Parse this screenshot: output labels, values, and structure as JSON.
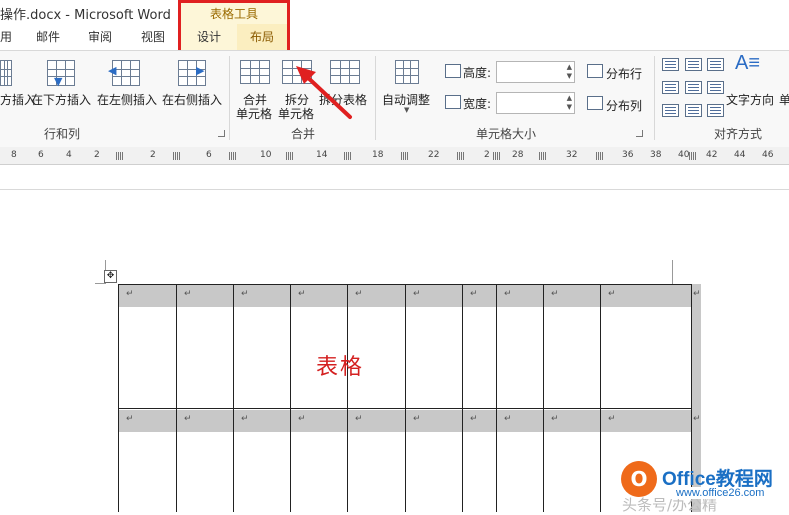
{
  "window": {
    "title": "操作.docx - Microsoft Word"
  },
  "tabs": [
    "用",
    "邮件",
    "审阅",
    "视图"
  ],
  "context_tabs": {
    "group_title": "表格工具",
    "design": "设计",
    "layout": "布局"
  },
  "ribbon": {
    "rows_cols": {
      "label": "行和列",
      "insert_above": "方插入",
      "insert_below": "在下方插入",
      "insert_left": "在左侧插入",
      "insert_right": "在右侧插入"
    },
    "merge": {
      "label": "合并",
      "merge_cells_1": "合并",
      "merge_cells_2": "单元格",
      "split_cells_1": "拆分",
      "split_cells_2": "单元格",
      "split_table": "拆分表格"
    },
    "cell_size": {
      "label": "单元格大小",
      "autofit": "自动调整",
      "height_label": "高度:",
      "width_label": "宽度:",
      "height_value": "",
      "width_value": "",
      "distribute_rows": "分布行",
      "distribute_cols": "分布列"
    },
    "alignment": {
      "label": "对齐方式",
      "text_direction": "文字方向",
      "cell_margins": "单"
    }
  },
  "ruler": [
    "8",
    "6",
    "4",
    "2",
    "2",
    "6",
    "10",
    "14",
    "18",
    "22",
    "2",
    "28",
    "32",
    "36",
    "38",
    "40",
    "42",
    "44",
    "46"
  ],
  "document": {
    "paragraph_mark": "↵",
    "table_text": "表格",
    "move_handle": "✥"
  },
  "watermark": {
    "brand": "Office教程网",
    "url": "www.office26.com",
    "author": "头条号/办公精"
  },
  "colors": {
    "highlight": "#e02020",
    "table_text": "#d42020",
    "context_tab_text": "#9a6a00",
    "brand": "#1a6fc4"
  }
}
